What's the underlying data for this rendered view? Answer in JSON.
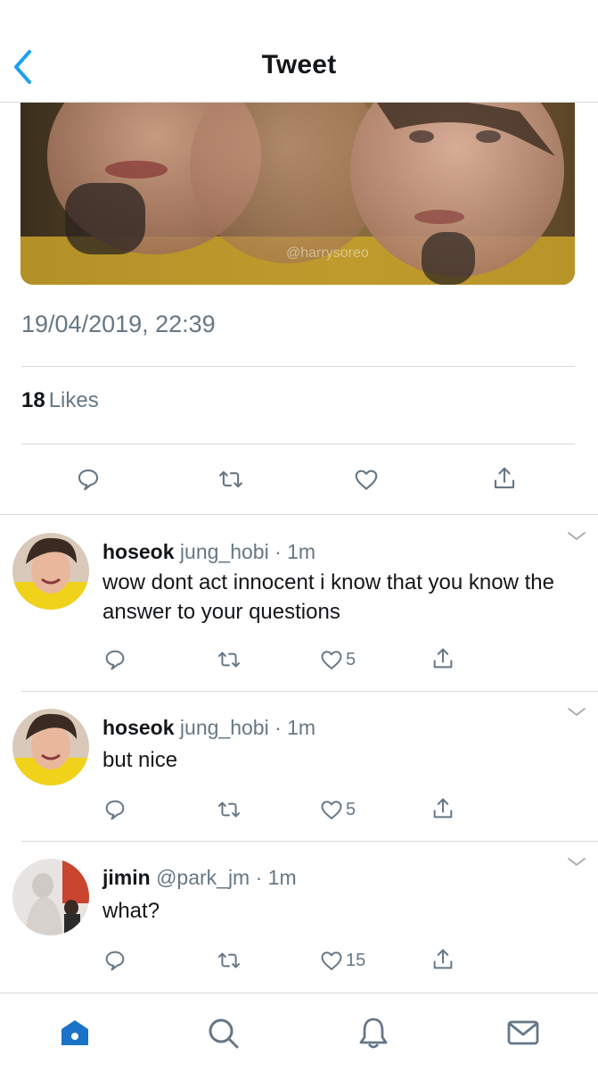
{
  "header": {
    "title": "Tweet"
  },
  "main_tweet": {
    "media_watermark": "@harrysoreo",
    "timestamp": "19/04/2019, 22:39",
    "likes_count": "18",
    "likes_label": "Likes"
  },
  "replies": [
    {
      "name": "hoseok",
      "handle": "jung_hobi",
      "time": "· 1m",
      "text": "wow dont act innocent i know that you know the answer to your questions",
      "like_count": "5"
    },
    {
      "name": "hoseok",
      "handle": "jung_hobi",
      "time": "· 1m",
      "text": "but nice",
      "like_count": "5"
    },
    {
      "name": "jimin",
      "handle": "@park_jm",
      "time": "· 1m",
      "text": "what?",
      "like_count": "15"
    }
  ],
  "colors": {
    "accent": "#1da1f2",
    "home_tab": "#1a73c8",
    "icon_gray": "#657786",
    "divider": "#d6d9dc"
  },
  "icons": {
    "header": [
      "chevron-left-icon"
    ],
    "actions": [
      "reply-icon",
      "retweet-icon",
      "like-icon",
      "share-icon"
    ],
    "tabs": [
      "home-icon",
      "search-icon",
      "notifications-icon",
      "messages-icon"
    ],
    "reply_menu": "chevron-down-icon"
  }
}
